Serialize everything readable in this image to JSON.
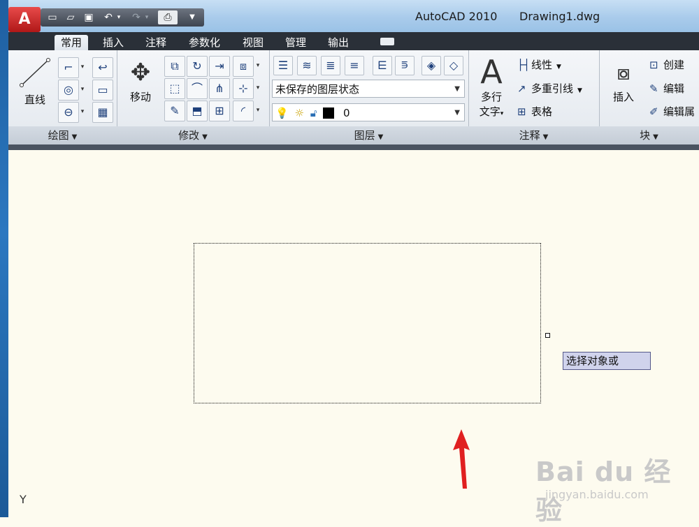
{
  "window": {
    "app_title": "AutoCAD 2010",
    "file_title": "Drawing1.dwg",
    "logo_letter": "A"
  },
  "quick_access": {
    "icons": [
      "new-icon",
      "open-icon",
      "save-icon",
      "undo-icon",
      "redo-icon",
      "plot-icon",
      "more-icon"
    ]
  },
  "tabs": [
    {
      "label": "常用",
      "active": true
    },
    {
      "label": "插入"
    },
    {
      "label": "注释"
    },
    {
      "label": "参数化"
    },
    {
      "label": "视图"
    },
    {
      "label": "管理"
    },
    {
      "label": "输出"
    }
  ],
  "panels": {
    "draw": {
      "title": "绘图",
      "line_label": "直线"
    },
    "modify": {
      "title": "修改",
      "move_label": "移动"
    },
    "layers": {
      "title": "图层",
      "layer_state": "未保存的图层状态",
      "current_layer": "0"
    },
    "annotation": {
      "title": "注释",
      "mtext_label_1": "多行",
      "mtext_label_2": "文字",
      "big_glyph": "A",
      "linear": "线性",
      "multileader": "多重引线",
      "table": "表格"
    },
    "block": {
      "title": "块",
      "insert": "插入",
      "create": "创建",
      "edit": "编辑",
      "edit_attr": "编辑属"
    }
  },
  "canvas": {
    "tooltip": "选择对象或",
    "ucs_label": "Y"
  },
  "watermark": {
    "main": "Bai du 经验",
    "sub": "jingyan.baidu.com"
  },
  "colors": {
    "canvas_bg": "#fdfbef",
    "ribbon_tab_bg": "#2a3038",
    "tooltip_bg": "#d0d3ec",
    "arrow_red": "#e02020"
  }
}
